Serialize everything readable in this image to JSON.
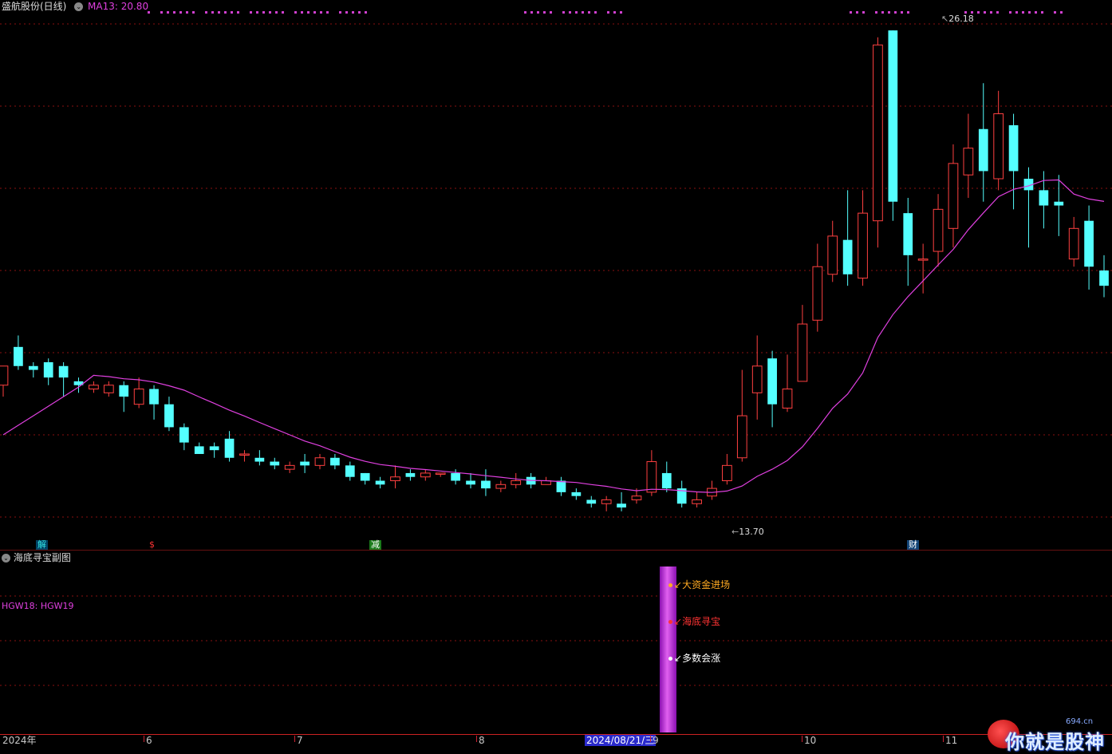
{
  "header": {
    "stock_name": "盛航股份(日线)",
    "ma_label": "MA13: 20.80"
  },
  "price_labels": {
    "high": "26.18",
    "low": "13.70"
  },
  "event_tags": [
    {
      "text": "解",
      "color": "#33e0e0",
      "bg": "#004466"
    },
    {
      "text": "$",
      "color": "#ff3333",
      "bg": "transparent"
    },
    {
      "text": "减",
      "color": "#ffffff",
      "bg": "#1a7a1a"
    },
    {
      "text": "财",
      "color": "#ffffff",
      "bg": "#124477"
    }
  ],
  "sub_panel": {
    "title": "海底寻宝副图",
    "indicator_label": "HGW18: HGW19",
    "signals": [
      {
        "text": "大资金进场",
        "color": "#ffaa22"
      },
      {
        "text": "海底寻宝",
        "color": "#ff3333"
      },
      {
        "text": "多数会涨",
        "color": "#ffffff"
      }
    ]
  },
  "x_axis": {
    "labels": [
      "2024年",
      "6",
      "7",
      "8",
      "9",
      "10",
      "11"
    ],
    "selected_date": "2024/08/21/三"
  },
  "watermark": {
    "text": "你就是股神",
    "site": "694.cn"
  },
  "colors": {
    "up": "#ff4040",
    "down": "#54ffff",
    "ma": "#e040e0",
    "grid": "#8a1010",
    "purple_bar": "#c030e0"
  },
  "chart_data": {
    "type": "candlestick",
    "title": "盛航股份(日线)",
    "series": [
      {
        "name": "MA13",
        "value_shown": 20.8
      }
    ],
    "high_marker": 26.18,
    "low_marker": 13.7,
    "ylim": [
      13.2,
      26.6
    ],
    "candles": [
      [
        16.9,
        17.4,
        16.6,
        17.4
      ],
      [
        17.9,
        17.4,
        17.3,
        18.2
      ],
      [
        17.4,
        17.3,
        17.1,
        17.5
      ],
      [
        17.5,
        17.1,
        16.9,
        17.6
      ],
      [
        17.4,
        17.1,
        16.6,
        17.5
      ],
      [
        17.0,
        16.9,
        16.7,
        17.1
      ],
      [
        16.8,
        16.9,
        16.7,
        17.0
      ],
      [
        16.7,
        16.9,
        16.6,
        17.0
      ],
      [
        16.9,
        16.6,
        16.2,
        17.0
      ],
      [
        16.4,
        16.8,
        16.3,
        17.1
      ],
      [
        16.8,
        16.4,
        16.0,
        16.9
      ],
      [
        16.4,
        15.8,
        15.7,
        16.6
      ],
      [
        15.8,
        15.4,
        15.2,
        15.9
      ],
      [
        15.3,
        15.1,
        15.1,
        15.4
      ],
      [
        15.3,
        15.2,
        15.0,
        15.4
      ],
      [
        15.5,
        15.0,
        14.9,
        15.7
      ],
      [
        15.1,
        15.1,
        14.9,
        15.2
      ],
      [
        15.0,
        14.9,
        14.8,
        15.2
      ],
      [
        14.9,
        14.8,
        14.7,
        15.0
      ],
      [
        14.7,
        14.8,
        14.6,
        14.9
      ],
      [
        14.9,
        14.8,
        14.6,
        15.1
      ],
      [
        14.8,
        15.0,
        14.7,
        15.1
      ],
      [
        15.0,
        14.8,
        14.7,
        15.1
      ],
      [
        14.8,
        14.5,
        14.4,
        14.9
      ],
      [
        14.6,
        14.4,
        14.3,
        14.6
      ],
      [
        14.4,
        14.3,
        14.2,
        14.5
      ],
      [
        14.4,
        14.5,
        14.2,
        14.8
      ],
      [
        14.6,
        14.5,
        14.4,
        14.7
      ],
      [
        14.5,
        14.6,
        14.4,
        14.7
      ],
      [
        14.6,
        14.6,
        14.5,
        14.6
      ],
      [
        14.6,
        14.4,
        14.3,
        14.7
      ],
      [
        14.4,
        14.3,
        14.2,
        14.6
      ],
      [
        14.4,
        14.2,
        14.0,
        14.7
      ],
      [
        14.2,
        14.3,
        14.1,
        14.4
      ],
      [
        14.3,
        14.4,
        14.2,
        14.6
      ],
      [
        14.5,
        14.3,
        14.2,
        14.6
      ],
      [
        14.3,
        14.4,
        14.3,
        14.5
      ],
      [
        14.4,
        14.1,
        14.0,
        14.5
      ],
      [
        14.1,
        14.0,
        13.9,
        14.2
      ],
      [
        13.9,
        13.8,
        13.7,
        14.0
      ],
      [
        13.8,
        13.9,
        13.6,
        14.0
      ],
      [
        13.8,
        13.7,
        13.6,
        14.1
      ],
      [
        13.9,
        14.0,
        13.8,
        14.2
      ],
      [
        14.1,
        14.9,
        14.0,
        15.2
      ],
      [
        14.6,
        14.2,
        14.1,
        14.9
      ],
      [
        14.2,
        13.8,
        13.7,
        14.4
      ],
      [
        13.8,
        13.9,
        13.7,
        14.1
      ],
      [
        14.0,
        14.2,
        13.9,
        14.4
      ],
      [
        14.4,
        14.8,
        14.3,
        15.1
      ],
      [
        15.0,
        16.1,
        14.9,
        17.3
      ],
      [
        16.7,
        17.4,
        16.0,
        18.2
      ],
      [
        17.6,
        16.4,
        15.8,
        17.8
      ],
      [
        16.3,
        16.8,
        16.2,
        17.7
      ],
      [
        17.0,
        18.5,
        17.0,
        19.0
      ],
      [
        18.6,
        20.0,
        18.3,
        20.6
      ],
      [
        19.8,
        20.8,
        19.6,
        21.2
      ],
      [
        20.7,
        19.8,
        19.5,
        22.0
      ],
      [
        19.7,
        21.4,
        19.5,
        22.0
      ],
      [
        21.2,
        25.8,
        20.5,
        26.0
      ],
      [
        26.18,
        21.7,
        21.2,
        26.18
      ],
      [
        21.4,
        20.3,
        19.5,
        21.8
      ],
      [
        20.2,
        20.2,
        19.3,
        20.6
      ],
      [
        20.4,
        21.5,
        20.0,
        21.9
      ],
      [
        21.0,
        22.7,
        20.5,
        23.2
      ],
      [
        22.4,
        23.1,
        21.8,
        24.0
      ],
      [
        23.6,
        22.5,
        21.7,
        24.8
      ],
      [
        22.3,
        24.0,
        22.0,
        24.6
      ],
      [
        23.7,
        22.5,
        21.5,
        24.0
      ],
      [
        22.3,
        22.0,
        20.5,
        22.6
      ],
      [
        22.0,
        21.6,
        21.0,
        22.5
      ],
      [
        21.7,
        21.6,
        20.8,
        22.4
      ],
      [
        20.2,
        21.0,
        20.0,
        21.3
      ],
      [
        21.2,
        20.0,
        19.4,
        21.6
      ],
      [
        19.9,
        19.5,
        19.2,
        20.3
      ]
    ]
  }
}
